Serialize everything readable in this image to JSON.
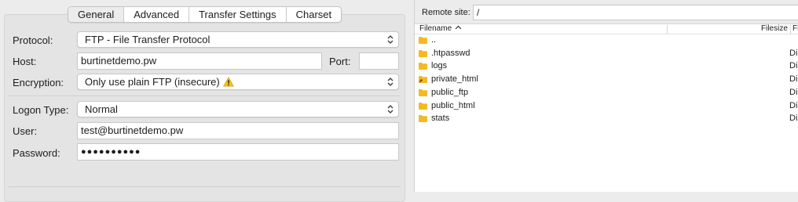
{
  "tabs": [
    "General",
    "Advanced",
    "Transfer Settings",
    "Charset"
  ],
  "active_tab": "General",
  "form": {
    "protocol_label": "Protocol:",
    "protocol_value": "FTP - File Transfer Protocol",
    "host_label": "Host:",
    "host_value": "burtinetdemo.pw",
    "port_label": "Port:",
    "port_value": "",
    "encryption_label": "Encryption:",
    "encryption_value": "Only use plain FTP (insecure)",
    "logon_type_label": "Logon Type:",
    "logon_type_value": "Normal",
    "user_label": "User:",
    "user_value": "test@burtinetdemo.pw",
    "password_label": "Password:",
    "password_mask": "●●●●●●●●●●"
  },
  "remote": {
    "site_label": "Remote site:",
    "site_path": "/",
    "columns": {
      "filename": "Filename",
      "filesize": "Filesize",
      "filetype": "Fi"
    },
    "files": [
      {
        "name": "..",
        "type": "",
        "icon": "folder-icon"
      },
      {
        "name": ".htpasswd",
        "type": "Di",
        "icon": "folder-icon"
      },
      {
        "name": "logs",
        "type": "Di",
        "icon": "folder-icon"
      },
      {
        "name": "private_html",
        "type": "Di",
        "icon": "folder-link-icon"
      },
      {
        "name": "public_ftp",
        "type": "Di",
        "icon": "folder-icon"
      },
      {
        "name": "public_html",
        "type": "Di",
        "icon": "folder-icon"
      },
      {
        "name": "stats",
        "type": "Di",
        "icon": "folder-icon"
      }
    ]
  },
  "colors": {
    "folder": "#f5b921",
    "warning": "#f0c419",
    "window_bg": "#ececec"
  }
}
